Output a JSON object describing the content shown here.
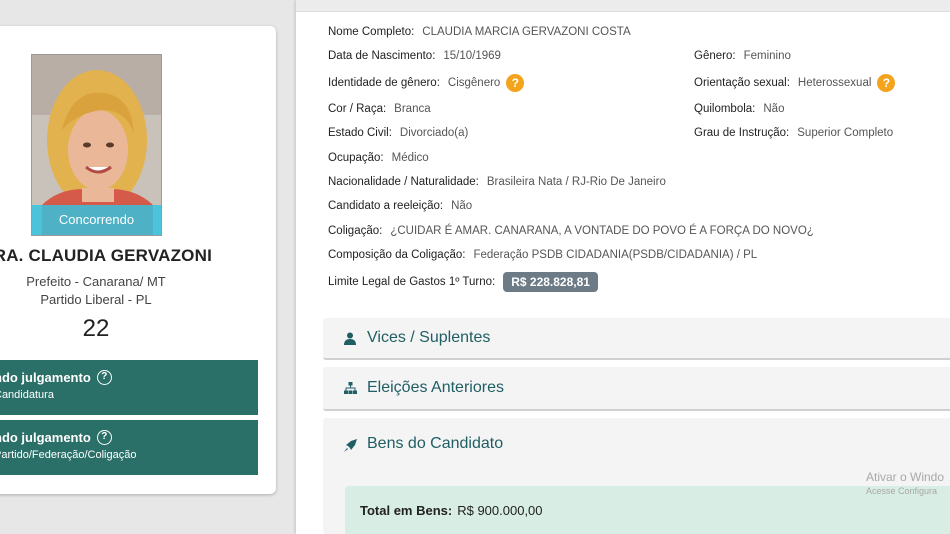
{
  "candidate": {
    "photo_badge": "Concorrendo",
    "name": "RA. CLAUDIA GERVAZONI",
    "office": "Prefeito - Canarana/ MT",
    "party": "Partido Liberal - PL",
    "number": "22",
    "status": [
      {
        "title": "ndo julgamento",
        "subtitle": "Candidatura"
      },
      {
        "title": "ndo julgamento",
        "subtitle": "Partido/Federação/Coligação"
      }
    ]
  },
  "details": {
    "nome_completo": {
      "label": "Nome Completo:",
      "value": "CLAUDIA MARCIA GERVAZONI COSTA"
    },
    "data_nascimento": {
      "label": "Data de Nascimento:",
      "value": "15/10/1969"
    },
    "genero": {
      "label": "Gênero:",
      "value": "Feminino"
    },
    "identidade_genero": {
      "label": "Identidade de gênero:",
      "value": "Cisgênero"
    },
    "orientacao_sexual": {
      "label": "Orientação sexual:",
      "value": "Heterossexual"
    },
    "cor_raca": {
      "label": "Cor / Raça:",
      "value": "Branca"
    },
    "quilombola": {
      "label": "Quilombola:",
      "value": "Não"
    },
    "estado_civil": {
      "label": "Estado Civil:",
      "value": "Divorciado(a)"
    },
    "grau_instrucao": {
      "label": "Grau de Instrução:",
      "value": "Superior Completo"
    },
    "ocupacao": {
      "label": "Ocupação:",
      "value": "Médico"
    },
    "nacionalidade": {
      "label": "Nacionalidade / Naturalidade:",
      "value": "Brasileira Nata / RJ-Rio De Janeiro"
    },
    "reeleicao": {
      "label": "Candidato a reeleição:",
      "value": "Não"
    },
    "coligacao": {
      "label": "Coligação:",
      "value": "¿CUIDAR É AMAR. CANARANA, A VONTADE DO POVO É A FORÇA DO NOVO¿"
    },
    "composicao": {
      "label": "Composição da Coligação:",
      "value": "Federação PSDB CIDADANIA(PSDB/CIDADANIA) / PL"
    },
    "limite_gastos": {
      "label": "Limite Legal de Gastos 1º Turno:",
      "value": "R$ 228.828,81"
    }
  },
  "help_badge": "?",
  "sections": {
    "vices": "Vices / Suplentes",
    "eleicoes": "Eleições Anteriores",
    "bens": "Bens do Candidato"
  },
  "bens": {
    "total_label": "Total em Bens:",
    "total_value": "R$ 900.000,00"
  },
  "watermark": {
    "line1": "Ativar o Windo",
    "line2": "Acesse Configura"
  },
  "colors": {
    "accent_teal": "#2a7068",
    "badge_orange": "#f3a41c",
    "photo_badge": "#30c4e0"
  }
}
